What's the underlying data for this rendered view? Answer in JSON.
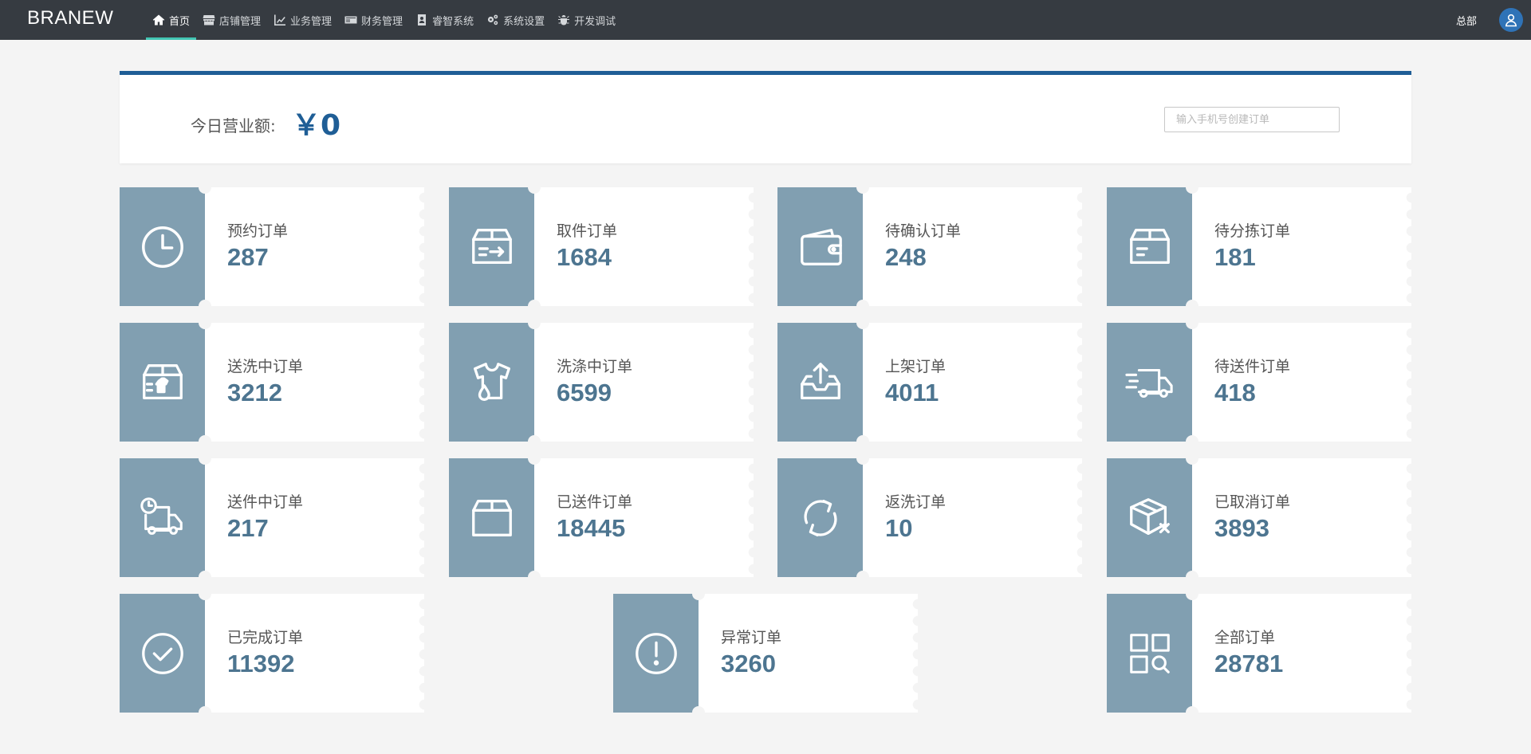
{
  "brand": "BRANEW",
  "nav": [
    {
      "label": "首页",
      "icon": "home-icon",
      "active": true
    },
    {
      "label": "店铺管理",
      "icon": "store-icon"
    },
    {
      "label": "业务管理",
      "icon": "chart-line-icon"
    },
    {
      "label": "财务管理",
      "icon": "money-icon"
    },
    {
      "label": "睿智系统",
      "icon": "contact-book-icon"
    },
    {
      "label": "系统设置",
      "icon": "gears-icon"
    },
    {
      "label": "开发调试",
      "icon": "bug-icon"
    }
  ],
  "user": {
    "name": "总部",
    "avatar_icon": "user-icon"
  },
  "revenue": {
    "label": "今日营业额:",
    "value": "￥0",
    "search_placeholder": "输入手机号创建订单"
  },
  "colors": {
    "topbar": "#363b41",
    "accent": "#43c6b4",
    "primary": "#1f5e96",
    "card_icon_bg": "#819fb1",
    "count": "#4d7590"
  },
  "orders": [
    {
      "title": "预约订单",
      "count": "287",
      "icon": "clock-icon"
    },
    {
      "title": "取件订单",
      "count": "1684",
      "icon": "box-arrow-icon"
    },
    {
      "title": "待确认订单",
      "count": "248",
      "icon": "wallet-icon"
    },
    {
      "title": "待分拣订单",
      "count": "181",
      "icon": "box-lines-icon"
    },
    {
      "title": "送洗中订单",
      "count": "3212",
      "icon": "box-shirt-icon"
    },
    {
      "title": "洗涤中订单",
      "count": "6599",
      "icon": "shirt-drop-icon"
    },
    {
      "title": "上架订单",
      "count": "4011",
      "icon": "tray-upload-icon"
    },
    {
      "title": "待送件订单",
      "count": "418",
      "icon": "fast-truck-icon"
    },
    {
      "title": "送件中订单",
      "count": "217",
      "icon": "truck-clock-icon"
    },
    {
      "title": "已送件订单",
      "count": "18445",
      "icon": "box-icon"
    },
    {
      "title": "返洗订单",
      "count": "10",
      "icon": "refresh-icon"
    },
    {
      "title": "已取消订单",
      "count": "3893",
      "icon": "box-cancel-icon"
    },
    {
      "title": "已完成订单",
      "count": "11392",
      "icon": "check-circle-icon"
    },
    {
      "title": "异常订单",
      "count": "3260",
      "icon": "exclamation-circle-icon"
    },
    {
      "title": "全部订单",
      "count": "28781",
      "icon": "grid-search-icon"
    }
  ]
}
